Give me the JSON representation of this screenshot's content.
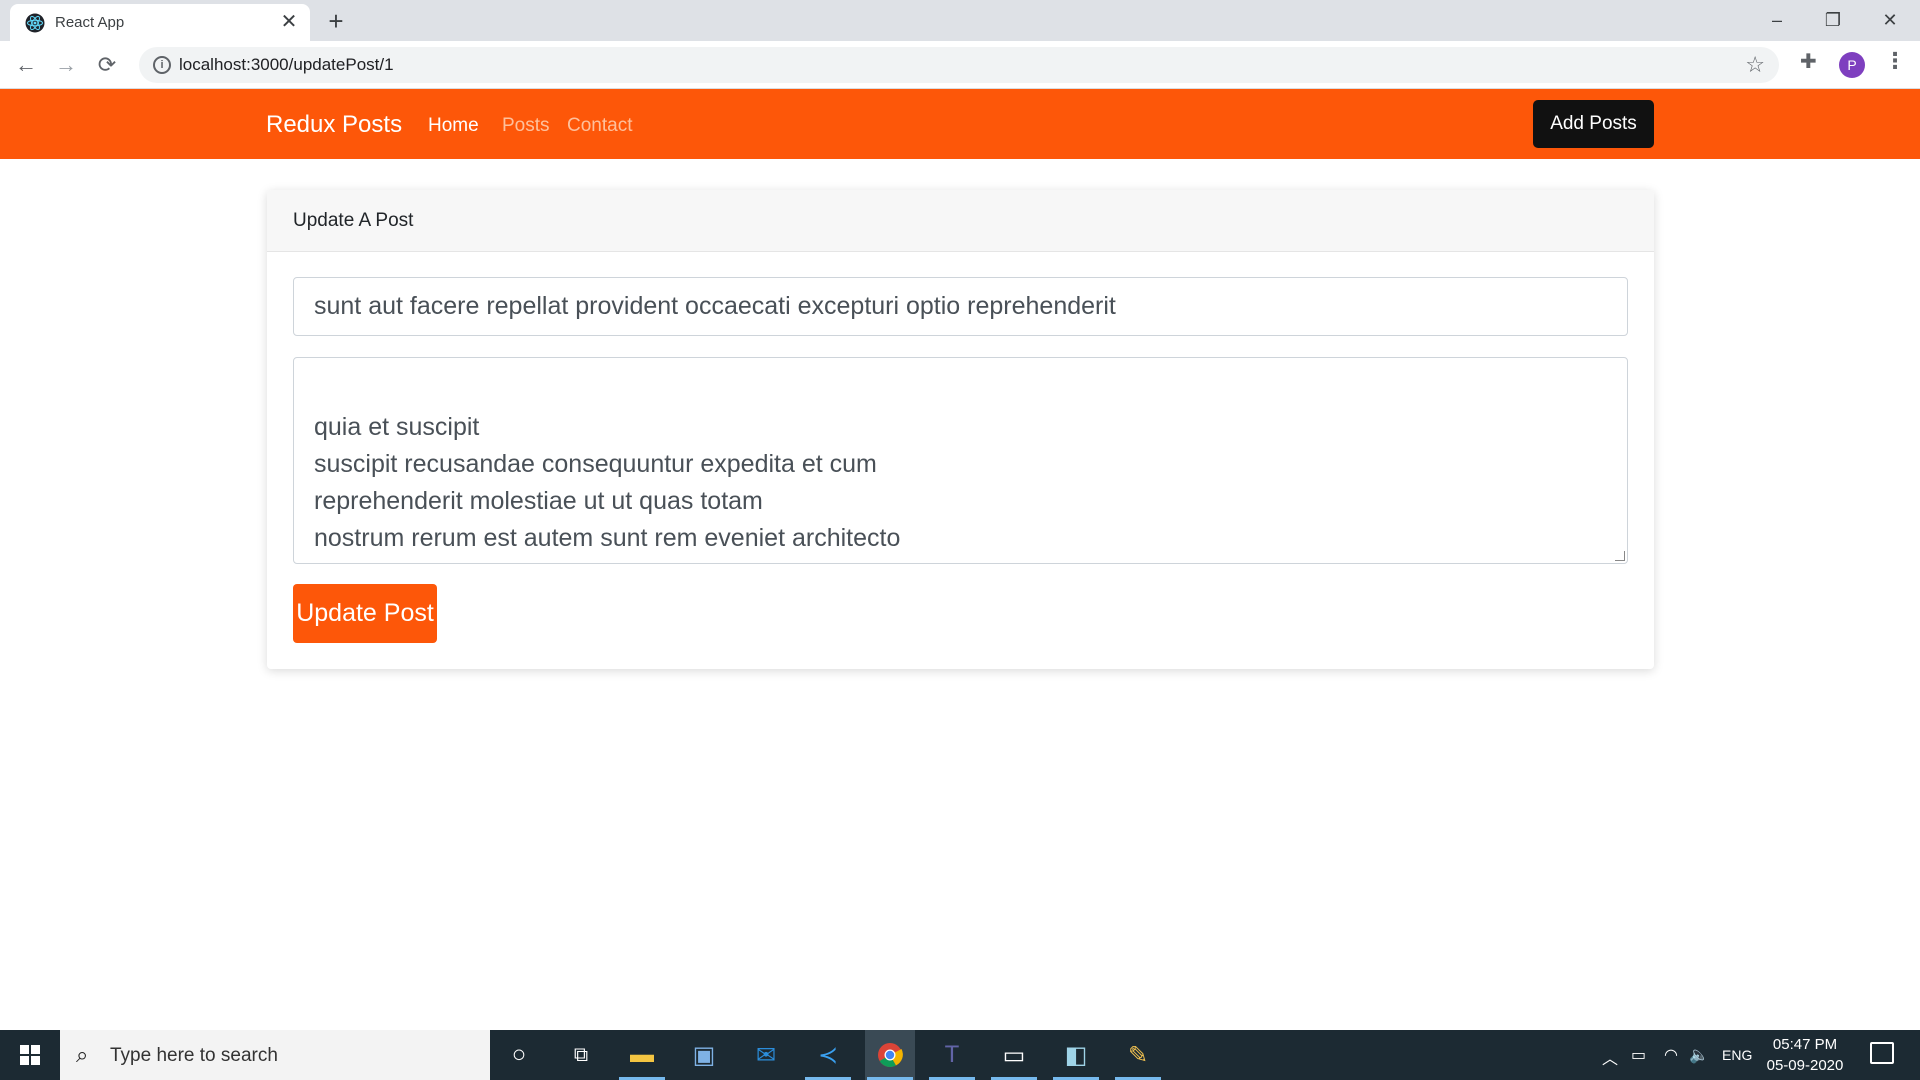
{
  "browser": {
    "tab_title": "React App",
    "tab_close": "✕",
    "new_tab": "+",
    "url": "localhost:3000/updatePost/1",
    "window_controls": {
      "minimize": "–",
      "restore": "❐",
      "close": "✕"
    },
    "profile_initial": "P"
  },
  "app": {
    "brand": "Redux Posts",
    "nav_links": {
      "home": "Home",
      "posts": "Posts",
      "contact": "Contact"
    },
    "add_posts_label": "Add Posts",
    "card": {
      "header": "Update A Post",
      "title_value": "sunt aut facere repellat provident occaecati excepturi optio reprehenderit",
      "body_value": "quia et suscipit\nsuscipit recusandae consequuntur expedita et cum\nreprehenderit molestiae ut ut quas totam\nnostrum rerum est autem sunt rem eveniet architecto",
      "submit_label": "Update Post"
    },
    "colors": {
      "accent": "#fd5709",
      "nav_link_active": "#ffffff",
      "nav_link_inactive": "#fec09c"
    }
  },
  "taskbar": {
    "search_placeholder": "Type here to search",
    "tray": {
      "language": "ENG"
    },
    "time": "05:47 PM",
    "date": "05-09-2020"
  }
}
